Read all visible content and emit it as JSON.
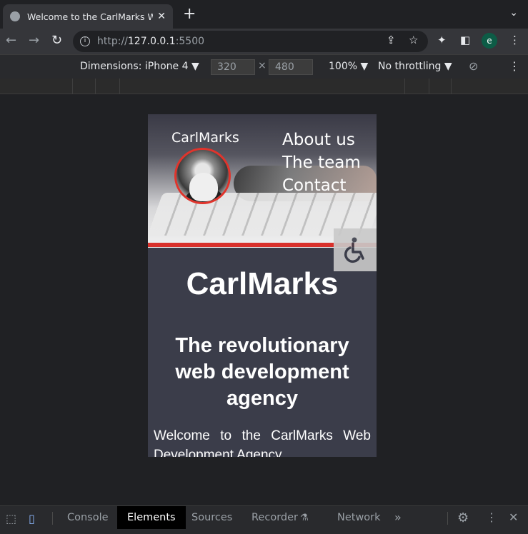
{
  "browser": {
    "tab_title": "Welcome to the CarlMarks Web",
    "tab_close": "✕",
    "new_tab": "+",
    "tab_menu": "⌄",
    "url_prefix": "http://",
    "url_host": "127.0.0.1",
    "url_port": ":5500",
    "avatar_letter": "e"
  },
  "device_toolbar": {
    "dimensions_label": "Dimensions: iPhone 4 ▼",
    "width": "320",
    "height": "480",
    "times": "×",
    "zoom": "100% ▼",
    "throttling": "No throttling ▼"
  },
  "site": {
    "logo_text": "CarlMarks",
    "nav": [
      "About us",
      "The team",
      "Contact"
    ],
    "title": "CarlMarks",
    "tagline": "The revolutionary web development agency",
    "intro": "Welcome to the CarlMarks Web Development Agency"
  },
  "devtools": {
    "tabs": [
      "Console",
      "Elements",
      "Sources",
      "Recorder",
      "Network"
    ],
    "more": "»"
  },
  "colors": {
    "accent_red": "#d9312b",
    "page_bg": "#3b3d4a",
    "browser_bg": "#202124"
  }
}
